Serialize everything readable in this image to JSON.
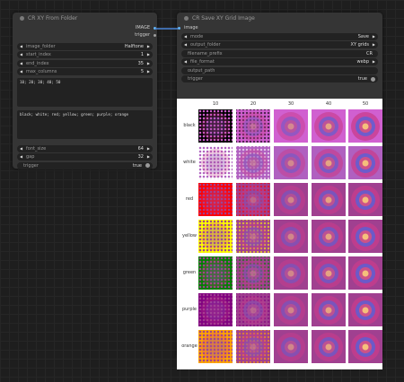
{
  "link_color": "#4a86d8",
  "left_node": {
    "title": "CR XY From Folder",
    "outputs": [
      {
        "label": "IMAGE",
        "color": "#64b5f6"
      },
      {
        "label": "trigger",
        "color": "#9e9e9e"
      }
    ],
    "widgets_top": [
      {
        "label": "image_folder",
        "value": "Halftone"
      },
      {
        "label": "start_index",
        "value": "1"
      },
      {
        "label": "end_index",
        "value": "35"
      },
      {
        "label": "max_columns",
        "value": "5"
      }
    ],
    "column_text": "10; 20; 30; 40; 50",
    "row_text": "black; white; red; yellow; green; purple; orange",
    "widgets_bottom": [
      {
        "label": "font_size",
        "value": "64"
      },
      {
        "label": "gap",
        "value": "32"
      }
    ],
    "toggle": {
      "label": "trigger",
      "value": "true"
    }
  },
  "right_node": {
    "title": "CR Save XY Grid Image",
    "input": {
      "label": "image",
      "color": "#64b5f6"
    },
    "widgets": [
      {
        "label": "mode",
        "value": "Save",
        "kind": "combo"
      },
      {
        "label": "output_folder",
        "value": "XY grids",
        "kind": "combo"
      },
      {
        "label": "filename_prefix",
        "value": "CR",
        "kind": "text"
      },
      {
        "label": "file_format",
        "value": "webp",
        "kind": "combo"
      },
      {
        "label": "output_path",
        "value": "",
        "kind": "text"
      }
    ],
    "toggle": {
      "label": "trigger",
      "value": "true"
    }
  },
  "grid": {
    "columns": [
      "10",
      "20",
      "30",
      "40",
      "50"
    ],
    "rows": [
      {
        "label": "black",
        "color": "#000000"
      },
      {
        "label": "white",
        "color": "#ffffff"
      },
      {
        "label": "red",
        "color": "#ff0000"
      },
      {
        "label": "yellow",
        "color": "#ffff00"
      },
      {
        "label": "green",
        "color": "#008000"
      },
      {
        "label": "purple",
        "color": "#800080"
      },
      {
        "label": "orange",
        "color": "#ffa500"
      }
    ]
  }
}
